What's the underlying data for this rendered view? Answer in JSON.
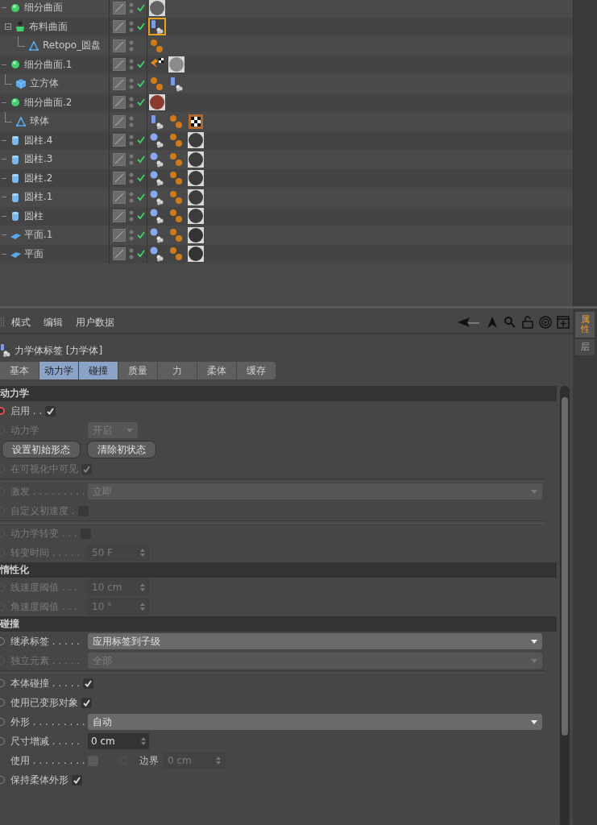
{
  "object_manager": {
    "objects": [
      {
        "name": "细分曲面",
        "kind": "subdivision",
        "checked": true,
        "expanded": true,
        "tags": [
          {
            "kind": "material",
            "color": "#626262",
            "selected": false
          }
        ],
        "children": [
          {
            "name": "布料曲面",
            "kind": "cloth",
            "checked": true,
            "expanded": true,
            "tags": [
              {
                "kind": "cloth",
                "selected": true
              }
            ],
            "children": [
              {
                "name": "Retopo_圆盘",
                "kind": "polygon",
                "checked": false,
                "tags": [
                  {
                    "kind": "dynamics",
                    "selected": false
                  }
                ]
              }
            ]
          }
        ]
      },
      {
        "name": "细分曲面.1",
        "kind": "subdivision",
        "checked": true,
        "expanded": true,
        "tags": [
          {
            "kind": "pin",
            "selected": false
          },
          {
            "kind": "material",
            "color": "#8a8a8a",
            "selected": false
          }
        ],
        "children": [
          {
            "name": "立方体",
            "kind": "cube",
            "checked": true,
            "tags": [
              {
                "kind": "dynamics",
                "selected": false
              },
              {
                "kind": "cloth",
                "selected": false
              }
            ]
          }
        ]
      },
      {
        "name": "细分曲面.2",
        "kind": "subdivision",
        "checked": true,
        "expanded": true,
        "tags": [
          {
            "kind": "material",
            "color": "#8a3a2e",
            "selected": false
          }
        ],
        "children": [
          {
            "name": "球体",
            "kind": "polygon",
            "checked": false,
            "tags": [
              {
                "kind": "cloth",
                "selected": false
              },
              {
                "kind": "dynamics",
                "selected": false
              },
              {
                "kind": "checker",
                "selected": false
              }
            ]
          }
        ]
      },
      {
        "name": "圆柱.4",
        "kind": "cylinder",
        "checked": true,
        "tags": [
          {
            "kind": "rigid",
            "selected": false
          },
          {
            "kind": "dynamics",
            "selected": false
          },
          {
            "kind": "material",
            "color": "#3c3c3c",
            "selected": false
          }
        ]
      },
      {
        "name": "圆柱.3",
        "kind": "cylinder",
        "checked": true,
        "tags": [
          {
            "kind": "rigid",
            "selected": false
          },
          {
            "kind": "dynamics",
            "selected": false
          },
          {
            "kind": "material",
            "color": "#3c3c3c",
            "selected": false
          }
        ]
      },
      {
        "name": "圆柱.2",
        "kind": "cylinder",
        "checked": true,
        "tags": [
          {
            "kind": "rigid",
            "selected": false
          },
          {
            "kind": "dynamics",
            "selected": false
          },
          {
            "kind": "material",
            "color": "#3c3c3c",
            "selected": false
          }
        ]
      },
      {
        "name": "圆柱.1",
        "kind": "cylinder",
        "checked": true,
        "tags": [
          {
            "kind": "rigid",
            "selected": false
          },
          {
            "kind": "dynamics",
            "selected": false
          },
          {
            "kind": "material",
            "color": "#3c3c3c",
            "selected": false
          }
        ]
      },
      {
        "name": "圆柱",
        "kind": "cylinder",
        "checked": true,
        "tags": [
          {
            "kind": "rigid",
            "selected": false
          },
          {
            "kind": "dynamics",
            "selected": false
          },
          {
            "kind": "material",
            "color": "#3c3c3c",
            "selected": false
          }
        ]
      },
      {
        "name": "平面.1",
        "kind": "plane",
        "checked": true,
        "tags": [
          {
            "kind": "rigid",
            "selected": false
          },
          {
            "kind": "dynamics",
            "selected": false
          },
          {
            "kind": "material",
            "color": "#333333",
            "selected": false
          }
        ]
      },
      {
        "name": "平面",
        "kind": "plane",
        "checked": true,
        "tags": [
          {
            "kind": "rigid",
            "selected": false
          },
          {
            "kind": "dynamics",
            "selected": false
          },
          {
            "kind": "material",
            "color": "#333333",
            "selected": false
          }
        ]
      }
    ]
  },
  "attributes": {
    "menu": [
      "模式",
      "编辑",
      "用户数据"
    ],
    "side_tabs": [
      {
        "label": "属性",
        "selected": true
      },
      {
        "label": "层",
        "selected": false
      }
    ],
    "title": "力学体标签 [力学体]",
    "tabs": [
      {
        "label": "基本",
        "selected": false
      },
      {
        "label": "动力学",
        "selected": true
      },
      {
        "label": "碰撞",
        "selected": true
      },
      {
        "label": "质量",
        "selected": false
      },
      {
        "label": "力",
        "selected": false
      },
      {
        "label": "柔体",
        "selected": false
      },
      {
        "label": "缓存",
        "selected": false
      }
    ],
    "sections": [
      {
        "title": "动力学",
        "rows": [
          {
            "kind": "check",
            "label": "启用 . .",
            "keyed": true,
            "enabled": true,
            "checked": true
          },
          {
            "kind": "dropdown",
            "label": "动力学",
            "keyed": false,
            "enabled": false,
            "value": "开启",
            "short": true
          },
          {
            "kind": "buttons",
            "buttons": [
              "设置初始形态",
              "清除初状态"
            ]
          },
          {
            "kind": "check",
            "label": "在可视化中可见",
            "keyed": false,
            "enabled": false,
            "checked": true
          },
          {
            "kind": "divider"
          },
          {
            "kind": "dropdown",
            "label": "激发 . . . . . . . . .",
            "keyed": false,
            "enabled": false,
            "value": "立即",
            "short": false
          },
          {
            "kind": "check",
            "label": "自定义初速度 .",
            "keyed": false,
            "enabled": false,
            "checked": false
          },
          {
            "kind": "divider"
          },
          {
            "kind": "check",
            "label": "动力学转变 . . .",
            "keyed": false,
            "enabled": false,
            "checked": false
          },
          {
            "kind": "number",
            "label": "转变时间 . . . . .",
            "keyed": false,
            "enabled": false,
            "value": "50 F"
          }
        ]
      },
      {
        "title": "惰性化",
        "rows": [
          {
            "kind": "number",
            "label": "线速度阈值 . . .",
            "keyed": false,
            "enabled": false,
            "value": "10 cm"
          },
          {
            "kind": "number",
            "label": "角速度阈值 . . .",
            "keyed": false,
            "enabled": false,
            "value": "10 °"
          }
        ]
      },
      {
        "title": "碰撞",
        "rows": [
          {
            "kind": "dropdown",
            "label": "继承标签 . . . . .",
            "keyed": false,
            "enabled": true,
            "value": "应用标签到子级",
            "short": false
          },
          {
            "kind": "dropdown",
            "label": "独立元素 . . . . .",
            "keyed": false,
            "enabled": false,
            "value": "全部",
            "short": false
          },
          {
            "kind": "divider"
          },
          {
            "kind": "check",
            "label": "本体碰撞 . . . . .",
            "keyed": false,
            "enabled": true,
            "checked": true
          },
          {
            "kind": "check",
            "label": "使用已变形对象",
            "keyed": false,
            "enabled": true,
            "checked": true
          },
          {
            "kind": "dropdown",
            "label": "外形 . . . . . . . . .",
            "keyed": false,
            "enabled": true,
            "value": "自动",
            "short": false
          },
          {
            "kind": "number",
            "label": "尺寸增减 . . . . .",
            "keyed": false,
            "enabled": true,
            "value": "0 cm"
          },
          {
            "kind": "check_pair",
            "label": "使用 . . . . . . . . .",
            "checked": false,
            "second_keyed": false,
            "second_label": "边界",
            "second_value": "0 cm"
          },
          {
            "kind": "check",
            "label": "保持柔体外形",
            "keyed": false,
            "enabled": true,
            "checked": true
          }
        ]
      }
    ]
  }
}
